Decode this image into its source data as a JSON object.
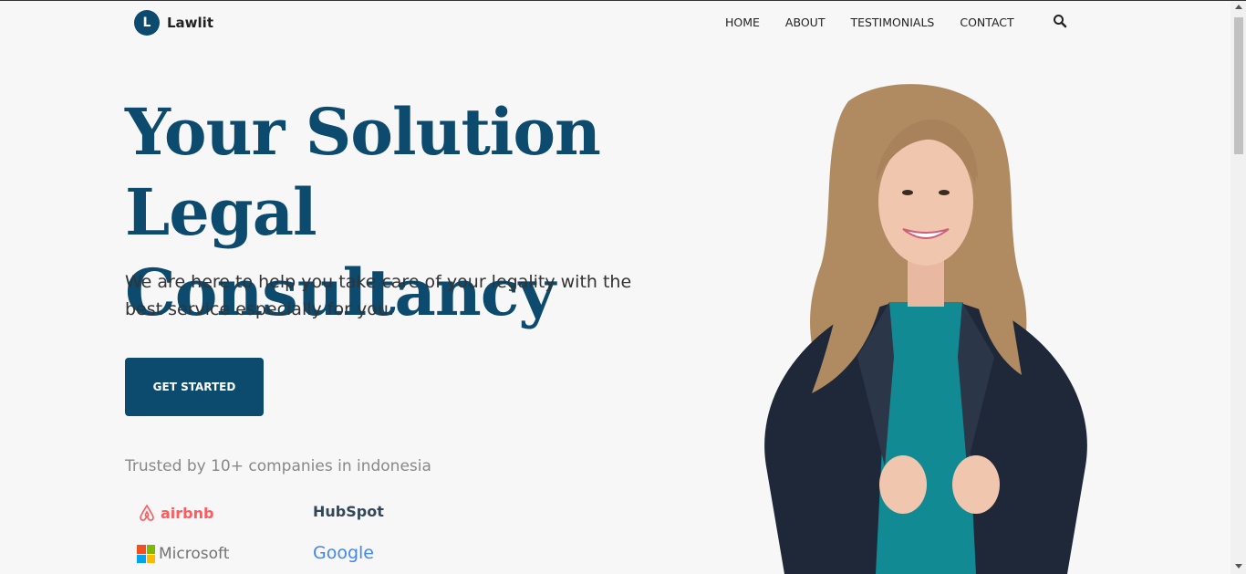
{
  "brand": {
    "logo_letter": "L",
    "name": "Lawlit"
  },
  "nav": {
    "home": "HOME",
    "about": "ABOUT",
    "testimonials": "TESTIMONIALS",
    "contact": "CONTACT",
    "search_icon": "search-icon"
  },
  "hero": {
    "title": "Your Solution Legal Consultancy",
    "subtitle": "We are here to help you take care of your legality with the best service especially for you.",
    "cta": "GET STARTED",
    "trusted": "Trusted by 10+ companies in indonesia"
  },
  "partners": {
    "airbnb": "airbnb",
    "hubspot": "HubSpot",
    "microsoft": "Microsoft",
    "google": "Google"
  },
  "colors": {
    "primary": "#0c4a6e",
    "background": "#f7f7f7"
  }
}
